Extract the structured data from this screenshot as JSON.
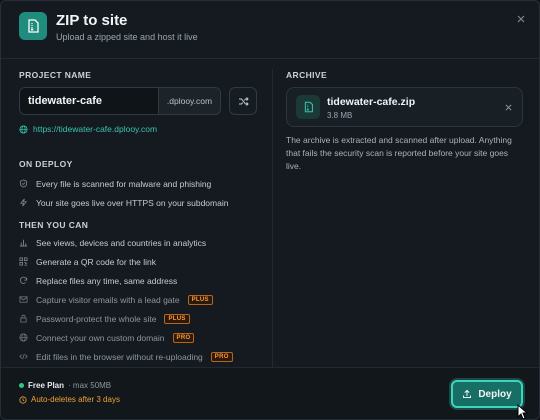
{
  "header": {
    "title": "ZIP to site",
    "subtitle": "Upload a zipped site and host it live"
  },
  "project": {
    "section_label": "PROJECT NAME",
    "name_value": "tidewater-cafe",
    "domain_suffix": ".dplooy.com",
    "url": "https://tidewater-cafe.dplooy.com"
  },
  "on_deploy": {
    "section_label": "ON DEPLOY",
    "items": [
      {
        "icon": "shield-check-icon",
        "label": "Every file is scanned for malware and phishing"
      },
      {
        "icon": "bolt-icon",
        "label": "Your site goes live over HTTPS on your subdomain"
      }
    ]
  },
  "then_you_can": {
    "section_label": "THEN YOU CAN",
    "items": [
      {
        "icon": "bar-chart-icon",
        "label": "See views, devices and countries in analytics",
        "badge": ""
      },
      {
        "icon": "qr-code-icon",
        "label": "Generate a QR code for the link",
        "badge": ""
      },
      {
        "icon": "refresh-icon",
        "label": "Replace files any time, same address",
        "badge": ""
      },
      {
        "icon": "mail-icon",
        "label": "Capture visitor emails with a lead gate",
        "badge": "PLUS"
      },
      {
        "icon": "lock-icon",
        "label": "Password-protect the whole site",
        "badge": "PLUS"
      },
      {
        "icon": "globe-icon",
        "label": "Connect your own custom domain",
        "badge": "PRO"
      },
      {
        "icon": "code-icon",
        "label": "Edit files in the browser without re-uploading",
        "badge": "PRO"
      }
    ]
  },
  "archive": {
    "section_label": "ARCHIVE",
    "file_name": "tidewater-cafe.zip",
    "file_size": "3.8 MB",
    "note": "The archive is extracted and scanned after upload. Anything that fails the security scan is reported before your site goes live."
  },
  "footer": {
    "plan_name": "Free Plan",
    "plan_limit": "· max 50MB",
    "warning": "Auto-deletes after 3 days",
    "deploy_label": "Deploy"
  },
  "colors": {
    "accent": "#1f8c7e",
    "link": "#39c5ad",
    "warning": "#f0a133",
    "badge": "#ff9933"
  }
}
